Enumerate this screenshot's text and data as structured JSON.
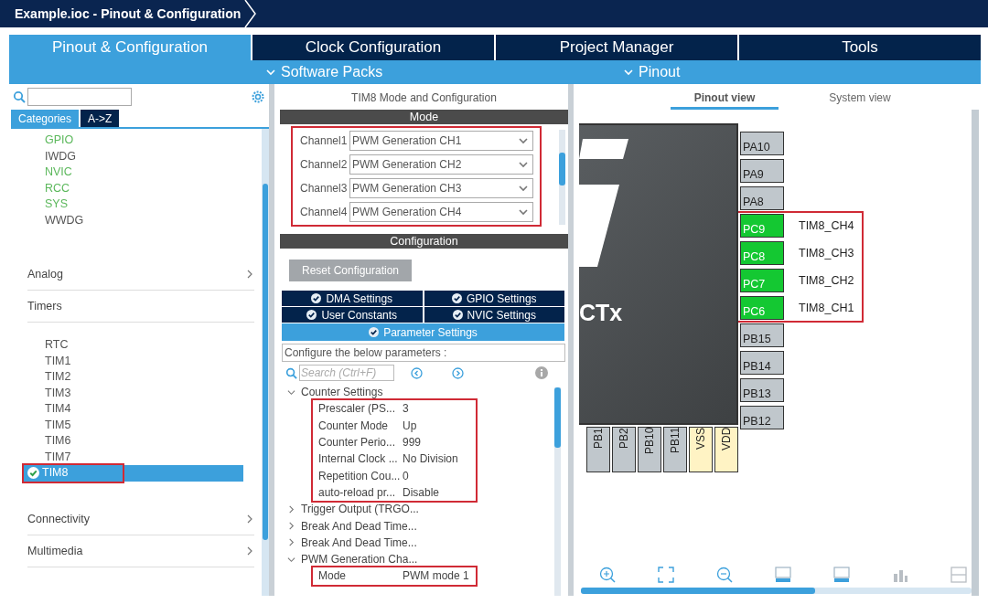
{
  "window": {
    "title": "Example.ioc - Pinout & Configuration"
  },
  "main_tabs": [
    {
      "label": "Pinout & Configuration",
      "selected": true
    },
    {
      "label": "Clock Configuration",
      "selected": false
    },
    {
      "label": "Project Manager",
      "selected": false
    },
    {
      "label": "Tools",
      "selected": false
    }
  ],
  "sub_menus": [
    {
      "label": "Software Packs"
    },
    {
      "label": "Pinout"
    }
  ],
  "left_panel": {
    "tabs": [
      {
        "label": "Categories",
        "selected": true
      },
      {
        "label": "A->Z",
        "selected": false
      }
    ],
    "system_items": [
      {
        "label": "GPIO",
        "configured": true
      },
      {
        "label": "IWDG",
        "configured": false
      },
      {
        "label": "NVIC",
        "configured": true
      },
      {
        "label": "RCC",
        "configured": true
      },
      {
        "label": "SYS",
        "configured": true
      },
      {
        "label": "WWDG",
        "configured": false
      }
    ],
    "categories": [
      {
        "label": "Analog",
        "expanded": false
      },
      {
        "label": "Timers",
        "expanded": true,
        "items": [
          {
            "label": "RTC",
            "configured": false,
            "selected": false,
            "highlight": false
          },
          {
            "label": "TIM1",
            "configured": false,
            "selected": false,
            "highlight": false
          },
          {
            "label": "TIM2",
            "configured": false,
            "selected": false,
            "highlight": false
          },
          {
            "label": "TIM3",
            "configured": false,
            "selected": false,
            "highlight": false
          },
          {
            "label": "TIM4",
            "configured": false,
            "selected": false,
            "highlight": false
          },
          {
            "label": "TIM5",
            "configured": false,
            "selected": false,
            "highlight": false
          },
          {
            "label": "TIM6",
            "configured": false,
            "selected": false,
            "highlight": false
          },
          {
            "label": "TIM7",
            "configured": false,
            "selected": false,
            "highlight": false
          },
          {
            "label": "TIM8",
            "configured": true,
            "selected": true,
            "highlight": true
          }
        ]
      },
      {
        "label": "Connectivity",
        "expanded": false
      },
      {
        "label": "Multimedia",
        "expanded": false
      }
    ]
  },
  "mode_panel": {
    "title": "TIM8 Mode and Configuration",
    "mode_header": "Mode",
    "highlight": true,
    "channels": [
      {
        "label": "Channel1",
        "value": "PWM Generation CH1"
      },
      {
        "label": "Channel2",
        "value": "PWM Generation CH2"
      },
      {
        "label": "Channel3",
        "value": "PWM Generation CH3"
      },
      {
        "label": "Channel4",
        "value": "PWM Generation CH4"
      }
    ],
    "config_header": "Configuration",
    "reset_button": {
      "label": "Reset Configuration",
      "disabled": true
    },
    "config_tabs": [
      {
        "label": "DMA Settings",
        "selected": false
      },
      {
        "label": "GPIO Settings",
        "selected": false
      },
      {
        "label": "User Constants",
        "selected": false
      },
      {
        "label": "NVIC Settings",
        "selected": false
      },
      {
        "label": "Parameter Settings",
        "selected": true
      }
    ],
    "hint": "Configure the below parameters :",
    "search": {
      "placeholder": "Search (Ctrl+F)"
    },
    "tree": [
      {
        "label": "Counter Settings",
        "expanded": true,
        "highlight": true,
        "children": [
          {
            "label": "Prescaler (PS...",
            "value": "3"
          },
          {
            "label": "Counter Mode",
            "value": "Up"
          },
          {
            "label": "Counter Perio...",
            "value": "999"
          },
          {
            "label": "Internal Clock ...",
            "value": "No Division"
          },
          {
            "label": "Repetition Cou...",
            "value": "0"
          },
          {
            "label": "auto-reload pr...",
            "value": "Disable"
          }
        ]
      },
      {
        "label": "Trigger Output (TRGO...",
        "expanded": false
      },
      {
        "label": "Break And Dead Time...",
        "expanded": false
      },
      {
        "label": "Break And Dead Time...",
        "expanded": false
      },
      {
        "label": "PWM Generation Cha...",
        "expanded": true,
        "highlight": true,
        "children": [
          {
            "label": "Mode",
            "value": "PWM mode 1"
          }
        ]
      }
    ]
  },
  "pinout_panel": {
    "view_tabs": [
      {
        "label": "Pinout view",
        "selected": true
      },
      {
        "label": "System view",
        "selected": false
      }
    ],
    "chip_label": "CTx",
    "pin_groups": [
      {
        "highlight": false,
        "pins": [
          {
            "name": "PA10",
            "kind": "io"
          },
          {
            "name": "PA9",
            "kind": "io"
          },
          {
            "name": "PA8",
            "kind": "io"
          }
        ]
      },
      {
        "highlight": true,
        "pins": [
          {
            "name": "PC9",
            "kind": "assigned",
            "signal": "TIM8_CH4"
          },
          {
            "name": "PC8",
            "kind": "assigned",
            "signal": "TIM8_CH3"
          },
          {
            "name": "PC7",
            "kind": "assigned",
            "signal": "TIM8_CH2"
          },
          {
            "name": "PC6",
            "kind": "assigned",
            "signal": "TIM8_CH1"
          }
        ]
      },
      {
        "highlight": false,
        "pins": [
          {
            "name": "PB15",
            "kind": "io"
          },
          {
            "name": "PB14",
            "kind": "io"
          },
          {
            "name": "PB13",
            "kind": "io"
          },
          {
            "name": "PB12",
            "kind": "io"
          }
        ]
      }
    ],
    "bottom_pins": [
      {
        "name": "PB1",
        "kind": "io"
      },
      {
        "name": "PB2",
        "kind": "io"
      },
      {
        "name": "PB10",
        "kind": "io"
      },
      {
        "name": "PB11",
        "kind": "io"
      },
      {
        "name": "VSS",
        "kind": "power"
      },
      {
        "name": "VDD",
        "kind": "power"
      }
    ]
  }
}
